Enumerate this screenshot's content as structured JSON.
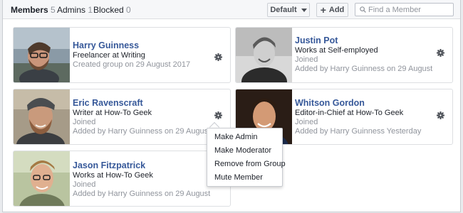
{
  "tabs": [
    {
      "label": "Members",
      "count": "5"
    },
    {
      "label": "Admins",
      "count": "1"
    },
    {
      "label": "Blocked",
      "count": "0"
    }
  ],
  "toolbar": {
    "sort_label": "Default",
    "add_label": "Add",
    "add_glyph": "+",
    "search_placeholder": "Find a Member"
  },
  "members": [
    {
      "name": "Harry Guinness",
      "role": "Freelancer at Writing",
      "meta1": "Created group on 29 August 2017",
      "meta2": ""
    },
    {
      "name": "Justin Pot",
      "role": "Works at Self-employed",
      "meta1": "Joined",
      "meta2": "Added by Harry Guinness on 29 August"
    },
    {
      "name": "Eric Ravenscraft",
      "role": "Writer at How-To Geek",
      "meta1": "Joined",
      "meta2": "Added by Harry Guinness on 29 August"
    },
    {
      "name": "Whitson Gordon",
      "role": "Editor-in-Chief at How-To Geek",
      "meta1": "Joined",
      "meta2": "Added by Harry Guinness Yesterday"
    },
    {
      "name": "Jason Fitzpatrick",
      "role": "Works at How-To Geek",
      "meta1": "Joined",
      "meta2": "Added by Harry Guinness on 29 August"
    }
  ],
  "menu": {
    "items": [
      "Make Admin",
      "Make Moderator",
      "Remove from Group",
      "Mute Member"
    ]
  },
  "icons": {
    "gear": "gear-icon",
    "search": "search-icon",
    "caret": "caret-down-icon"
  },
  "colors": {
    "name_link": "#365899",
    "secondary_text": "#90949c",
    "primary_text": "#1d2129",
    "border": "#dddfe2"
  }
}
